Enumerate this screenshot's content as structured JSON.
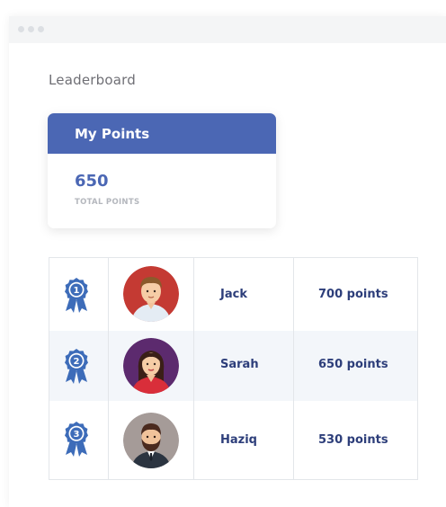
{
  "page": {
    "title": "Leaderboard"
  },
  "my_points": {
    "header": "My Points",
    "value": "650",
    "caption": "TOTAL POINTS"
  },
  "leaderboard": [
    {
      "rank": "1",
      "name": "Jack",
      "points": "700 points",
      "avatar": "male-avatar-brown-hair-icon"
    },
    {
      "rank": "2",
      "name": "Sarah",
      "points": "650 points",
      "avatar": "female-avatar-dark-hair-icon"
    },
    {
      "rank": "3",
      "name": "Haziq",
      "points": "530 points",
      "avatar": "male-avatar-beard-icon"
    }
  ],
  "colors": {
    "accent": "#4b67b4",
    "text_dark": "#2d3e7a",
    "medal": "#3d6cb9",
    "row_alt": "#f3f6fa"
  }
}
